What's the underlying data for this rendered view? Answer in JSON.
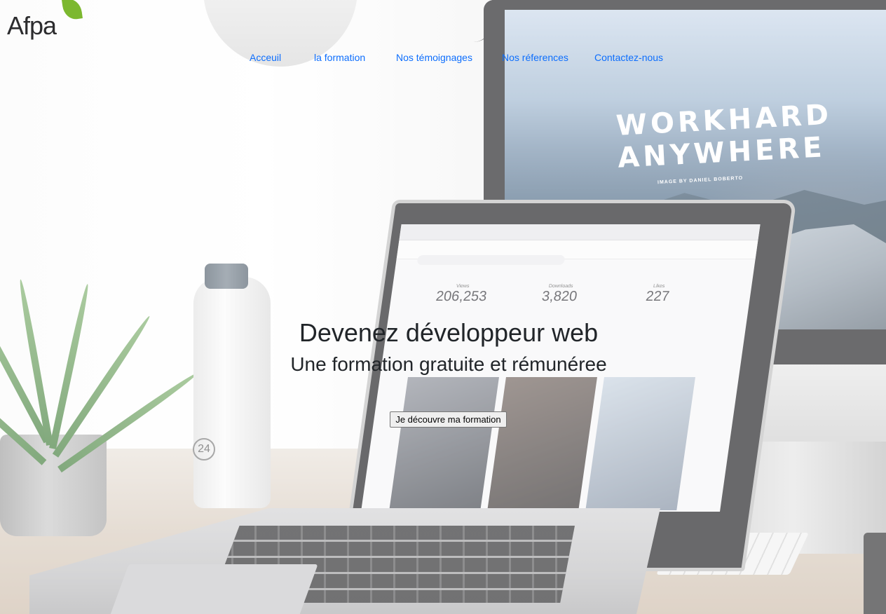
{
  "brand": {
    "logo_text": "Afpa",
    "accent": "#7cb82f"
  },
  "nav": {
    "link_color": "#0d6efd",
    "items": [
      {
        "label": "Acceuil"
      },
      {
        "label": "la formation"
      },
      {
        "label": "Nos témoignages"
      },
      {
        "label": "Nos réferences"
      },
      {
        "label": "Contactez-nous"
      }
    ]
  },
  "hero": {
    "title": "Devenez développeur web",
    "subtitle": "Une formation gratuite et rémunéree",
    "cta_label": "Je découvre ma formation",
    "background": {
      "imac_text_line1": "WORKHARD",
      "imac_text_line2": "ANYWHERE",
      "imac_caption": "IMAGE BY DANIEL BOBERTO",
      "laptop_stats": [
        {
          "label": "Views",
          "value": "206,253"
        },
        {
          "label": "Downloads",
          "value": "3,820"
        },
        {
          "label": "Likes",
          "value": "227"
        }
      ],
      "bottle_mark": "24"
    }
  }
}
